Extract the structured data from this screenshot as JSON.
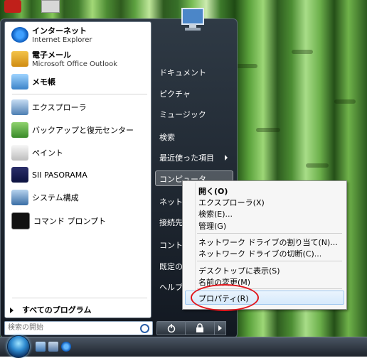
{
  "start_menu": {
    "pinned": [
      {
        "title": "インターネット",
        "subtitle": "Internet Explorer"
      },
      {
        "title": "電子メール",
        "subtitle": "Microsoft Office Outlook"
      },
      {
        "title": "メモ帳",
        "subtitle": ""
      }
    ],
    "recent": [
      {
        "label": "エクスプローラ"
      },
      {
        "label": "バックアップと復元センター"
      },
      {
        "label": "ペイント"
      },
      {
        "label": "SII PASORAMA"
      },
      {
        "label": "システム構成"
      },
      {
        "label": "コマンド プロンプト"
      }
    ],
    "all_programs": "すべてのプログラム",
    "search_placeholder": "検索の開始",
    "right_items": {
      "documents": "ドキュメント",
      "pictures": "ピクチャ",
      "music": "ミュージック",
      "search": "検索",
      "recent_items": "最近使った項目",
      "computer": "コンピュータ",
      "network": "ネット",
      "connect": "接続先",
      "control": "コント",
      "default": "既定の",
      "help": "ヘルプ"
    }
  },
  "context_menu": {
    "open": "開く(O)",
    "explore": "エクスプローラ(X)",
    "search": "検索(E)...",
    "manage": "管理(G)",
    "map_drive": "ネットワーク ドライブの割り当て(N)...",
    "disconnect_drive": "ネットワーク ドライブの切断(C)...",
    "show_on_desktop": "デスクトップに表示(S)",
    "rename": "名前の変更(M)",
    "properties": "プロパティ(R)"
  },
  "colors": {
    "annotation": "#e2141b",
    "menu_bg": "#1b222b"
  }
}
